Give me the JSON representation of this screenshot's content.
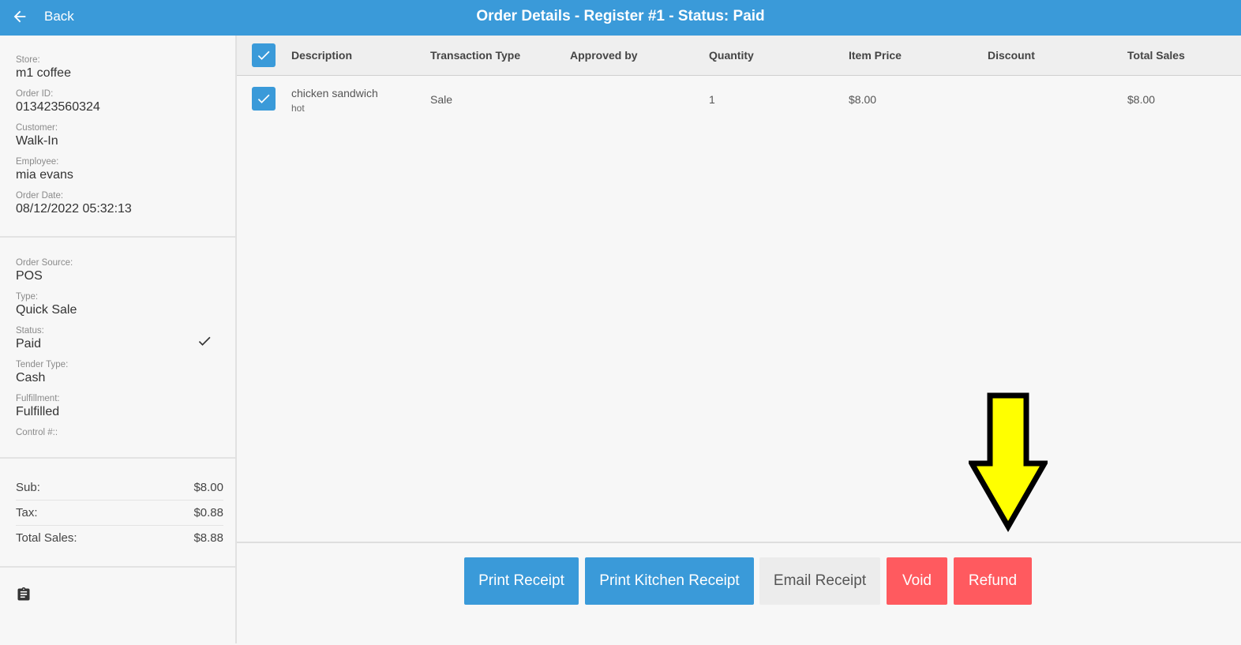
{
  "header": {
    "back_label": "Back",
    "title": "Order Details - Register #1 - Status: Paid"
  },
  "order_info": [
    {
      "label": "Store:",
      "value": "m1 coffee"
    },
    {
      "label": "Order ID:",
      "value": "013423560324"
    },
    {
      "label": "Customer:",
      "value": "Walk-In"
    },
    {
      "label": "Employee:",
      "value": "mia evans"
    },
    {
      "label": "Order Date:",
      "value": "08/12/2022 05:32:13"
    }
  ],
  "order_meta": [
    {
      "label": "Order Source:",
      "value": "POS"
    },
    {
      "label": "Type:",
      "value": "Quick Sale"
    },
    {
      "label": "Status:",
      "value": "Paid"
    },
    {
      "label": "Tender Type:",
      "value": "Cash"
    },
    {
      "label": "Fulfillment:",
      "value": "Fulfilled"
    },
    {
      "label": "Control #::",
      "value": ""
    }
  ],
  "totals": [
    {
      "label": "Sub:",
      "value": "$8.00"
    },
    {
      "label": "Tax:",
      "value": "$0.88"
    },
    {
      "label": "Total Sales:",
      "value": "$8.88"
    }
  ],
  "table": {
    "columns": [
      "Description",
      "Transaction Type",
      "Approved by",
      "Quantity",
      "Item Price",
      "Discount",
      "Total Sales"
    ],
    "rows": [
      {
        "description": "chicken sandwich",
        "modifier": "hot",
        "transaction_type": "Sale",
        "approved_by": "",
        "quantity": "1",
        "item_price": "$8.00",
        "discount": "",
        "total_sales": "$8.00",
        "selected": true
      }
    ]
  },
  "actions": {
    "print_receipt": "Print Receipt",
    "print_kitchen_receipt": "Print Kitchen Receipt",
    "email_receipt": "Email Receipt",
    "void": "Void",
    "refund": "Refund"
  },
  "colors": {
    "primary": "#3a9ad9",
    "danger": "#ff5a5f",
    "neutral_button": "#ececec",
    "annotation_arrow": "#ffff00"
  },
  "icons": {
    "back": "arrow-left-icon",
    "status": "check-icon",
    "notes": "clipboard-icon",
    "annotation": "down-arrow-annotation"
  }
}
